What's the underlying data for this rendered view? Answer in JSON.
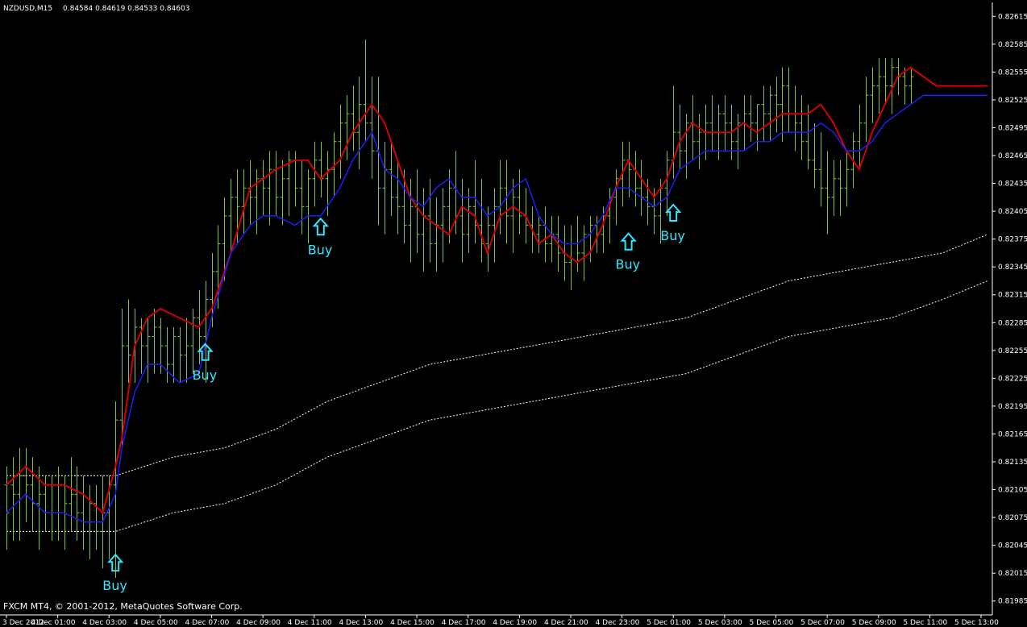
{
  "header": {
    "symbol": "NZDUSD,M15",
    "ohlc": "0.84584 0.84619 0.84533 0.84603"
  },
  "footer": {
    "copyright": "FXCM MT4, © 2001-2012, MetaQuotes Software Corp."
  },
  "colors": {
    "background": "#000000",
    "axis": "#ffffff",
    "bars": "#7ec63a",
    "ma_red": "#d40000",
    "ma_blue": "#1c1cff",
    "channel": "#ffffff",
    "signal": "#33e6ff"
  },
  "chart_data": {
    "type": "line",
    "ylim": [
      0.8197,
      0.8263
    ],
    "y_ticks": [
      "0.82615",
      "0.82585",
      "0.82555",
      "0.82525",
      "0.82495",
      "0.82465",
      "0.82435",
      "0.82405",
      "0.82375",
      "0.82345",
      "0.82315",
      "0.82285",
      "0.82255",
      "0.82225",
      "0.82195",
      "0.82165",
      "0.82135",
      "0.82105",
      "0.82075",
      "0.82045",
      "0.82015",
      "0.81985"
    ],
    "x_ticks": [
      "3 Dec 2012",
      "4 Dec 01:00",
      "4 Dec 03:00",
      "4 Dec 05:00",
      "4 Dec 07:00",
      "4 Dec 09:00",
      "4 Dec 11:00",
      "4 Dec 13:00",
      "4 Dec 15:00",
      "4 Dec 17:00",
      "4 Dec 19:00",
      "4 Dec 21:00",
      "4 Dec 23:00",
      "5 Dec 01:00",
      "5 Dec 03:00",
      "5 Dec 05:00",
      "5 Dec 07:00",
      "5 Dec 09:00",
      "5 Dec 11:00",
      "5 Dec 13:00"
    ],
    "x_tick_positions": [
      0,
      8,
      16,
      24,
      32,
      40,
      48,
      56,
      64,
      72,
      80,
      88,
      96,
      104,
      112,
      120,
      128,
      136,
      144,
      152
    ],
    "x_domain": [
      0,
      153
    ],
    "grid": false,
    "series": [
      {
        "role": "ma_red",
        "x": [
          0,
          3,
          6,
          9,
          12,
          15,
          17,
          18,
          20,
          22,
          24,
          27,
          30,
          32,
          35,
          38,
          40,
          42,
          45,
          47,
          49,
          52,
          54,
          56,
          57,
          59,
          61,
          63,
          65,
          67,
          69,
          71,
          73,
          75,
          77,
          79,
          81,
          83,
          85,
          87,
          89,
          91,
          93,
          95,
          97,
          99,
          101,
          103,
          105,
          107,
          109,
          111,
          113,
          115,
          117,
          119,
          121,
          123,
          125,
          127,
          129,
          131,
          133,
          135,
          137,
          139,
          141,
          143,
          145,
          147,
          149,
          151,
          153
        ],
        "y": [
          0.8211,
          0.8213,
          0.8211,
          0.8211,
          0.821,
          0.8208,
          0.8213,
          0.8216,
          0.8226,
          0.8229,
          0.823,
          0.8229,
          0.8228,
          0.823,
          0.8236,
          0.8243,
          0.8244,
          0.8245,
          0.8246,
          0.8246,
          0.8244,
          0.8246,
          0.8249,
          0.8251,
          0.8252,
          0.825,
          0.8246,
          0.8242,
          0.824,
          0.8239,
          0.8238,
          0.8241,
          0.824,
          0.8236,
          0.824,
          0.8241,
          0.824,
          0.8237,
          0.8238,
          0.8236,
          0.8235,
          0.8236,
          0.8239,
          0.8243,
          0.8246,
          0.8244,
          0.8242,
          0.8244,
          0.8248,
          0.825,
          0.8249,
          0.8249,
          0.8249,
          0.825,
          0.8249,
          0.825,
          0.8251,
          0.8251,
          0.8251,
          0.8252,
          0.825,
          0.8247,
          0.8245,
          0.8249,
          0.8252,
          0.8255,
          0.8256,
          0.8255,
          0.8254,
          0.8254,
          0.8254,
          0.8254,
          0.8254
        ]
      },
      {
        "role": "ma_blue",
        "x": [
          0,
          3,
          6,
          9,
          12,
          15,
          17,
          18,
          20,
          22,
          24,
          27,
          30,
          32,
          35,
          38,
          40,
          42,
          45,
          47,
          49,
          52,
          54,
          56,
          57,
          59,
          61,
          63,
          65,
          67,
          69,
          71,
          73,
          75,
          77,
          79,
          81,
          83,
          85,
          87,
          89,
          91,
          93,
          95,
          97,
          99,
          101,
          103,
          105,
          107,
          109,
          111,
          113,
          115,
          117,
          119,
          121,
          123,
          125,
          127,
          129,
          131,
          133,
          135,
          137,
          139,
          141,
          143,
          145,
          147,
          149,
          151,
          153
        ],
        "y": [
          0.8208,
          0.821,
          0.8208,
          0.8208,
          0.8207,
          0.8207,
          0.821,
          0.8215,
          0.8221,
          0.8224,
          0.8224,
          0.8222,
          0.8223,
          0.8229,
          0.8236,
          0.8239,
          0.824,
          0.824,
          0.8239,
          0.824,
          0.824,
          0.8243,
          0.8246,
          0.8248,
          0.8249,
          0.8245,
          0.8244,
          0.8242,
          0.8241,
          0.8243,
          0.8244,
          0.8242,
          0.8242,
          0.824,
          0.8241,
          0.8243,
          0.8244,
          0.824,
          0.8238,
          0.8237,
          0.8237,
          0.8238,
          0.824,
          0.8243,
          0.8243,
          0.8242,
          0.8241,
          0.8242,
          0.8245,
          0.8246,
          0.8247,
          0.8247,
          0.8247,
          0.8247,
          0.8248,
          0.8248,
          0.8249,
          0.8249,
          0.8249,
          0.825,
          0.8249,
          0.8247,
          0.8247,
          0.8248,
          0.825,
          0.8251,
          0.8252,
          0.8253,
          0.8253,
          0.8253,
          0.8253,
          0.8253,
          0.8253
        ]
      },
      {
        "role": "channel",
        "x": [
          0,
          17,
          26,
          34,
          42,
          50,
          58,
          66,
          74,
          82,
          90,
          98,
          106,
          114,
          122,
          130,
          138,
          146,
          153
        ],
        "y": [
          0.8212,
          0.8212,
          0.8214,
          0.8215,
          0.8217,
          0.822,
          0.8222,
          0.8224,
          0.8225,
          0.8226,
          0.8227,
          0.8228,
          0.8229,
          0.8231,
          0.8233,
          0.8234,
          0.8235,
          0.8236,
          0.8238
        ]
      },
      {
        "role": "channel",
        "x": [
          0,
          17,
          26,
          34,
          42,
          50,
          58,
          66,
          74,
          82,
          90,
          98,
          106,
          114,
          122,
          130,
          138,
          146,
          153
        ],
        "y": [
          0.8206,
          0.8206,
          0.8208,
          0.8209,
          0.8211,
          0.8214,
          0.8216,
          0.8218,
          0.8219,
          0.822,
          0.8221,
          0.8222,
          0.8223,
          0.8225,
          0.8227,
          0.8228,
          0.8229,
          0.8231,
          0.8233
        ]
      }
    ],
    "bars": [
      [
        0.8211,
        0.8213,
        0.8204,
        0.8208
      ],
      [
        0.8211,
        0.8214,
        0.8205,
        0.821
      ],
      [
        0.821,
        0.8215,
        0.8205,
        0.8212
      ],
      [
        0.8212,
        0.8215,
        0.8207,
        0.8211
      ],
      [
        0.8211,
        0.8214,
        0.8206,
        0.8209
      ],
      [
        0.8209,
        0.8213,
        0.8204,
        0.821
      ],
      [
        0.821,
        0.8212,
        0.8206,
        0.8208
      ],
      [
        0.8208,
        0.8212,
        0.8205,
        0.8211
      ],
      [
        0.8211,
        0.8213,
        0.8205,
        0.8208
      ],
      [
        0.8208,
        0.8212,
        0.8204,
        0.8209
      ],
      [
        0.8209,
        0.8214,
        0.8206,
        0.821
      ],
      [
        0.821,
        0.8213,
        0.8205,
        0.8208
      ],
      [
        0.8208,
        0.8212,
        0.8204,
        0.8207
      ],
      [
        0.8207,
        0.8211,
        0.8203,
        0.8209
      ],
      [
        0.8209,
        0.8211,
        0.8204,
        0.8206
      ],
      [
        0.8206,
        0.8212,
        0.8202,
        0.8208
      ],
      [
        0.8208,
        0.8212,
        0.8203,
        0.8211
      ],
      [
        0.8211,
        0.822,
        0.8201,
        0.8218
      ],
      [
        0.8218,
        0.823,
        0.8215,
        0.8226
      ],
      [
        0.8226,
        0.8231,
        0.8222,
        0.8225
      ],
      [
        0.8225,
        0.823,
        0.8222,
        0.8228
      ],
      [
        0.8228,
        0.8229,
        0.8223,
        0.8226
      ],
      [
        0.8226,
        0.8229,
        0.8222,
        0.8227
      ],
      [
        0.8227,
        0.823,
        0.8223,
        0.8228
      ],
      [
        0.8228,
        0.8229,
        0.8223,
        0.8226
      ],
      [
        0.8226,
        0.8228,
        0.8222,
        0.8224
      ],
      [
        0.8224,
        0.8228,
        0.8222,
        0.8227
      ],
      [
        0.8227,
        0.8228,
        0.8222,
        0.8225
      ],
      [
        0.8225,
        0.8229,
        0.8222,
        0.8226
      ],
      [
        0.8226,
        0.823,
        0.8223,
        0.8229
      ],
      [
        0.8229,
        0.8232,
        0.8224,
        0.8227
      ],
      [
        0.8227,
        0.8233,
        0.8222,
        0.8231
      ],
      [
        0.8231,
        0.8236,
        0.8228,
        0.8234
      ],
      [
        0.8234,
        0.8239,
        0.823,
        0.8237
      ],
      [
        0.8237,
        0.8242,
        0.8233,
        0.824
      ],
      [
        0.824,
        0.8244,
        0.8236,
        0.8242
      ],
      [
        0.8242,
        0.8245,
        0.8237,
        0.8241
      ],
      [
        0.8241,
        0.8245,
        0.8238,
        0.8243
      ],
      [
        0.8243,
        0.8246,
        0.8239,
        0.8242
      ],
      [
        0.8242,
        0.8245,
        0.8238,
        0.8244
      ],
      [
        0.8244,
        0.8246,
        0.824,
        0.8243
      ],
      [
        0.8243,
        0.8247,
        0.8239,
        0.8245
      ],
      [
        0.8245,
        0.8247,
        0.824,
        0.8242
      ],
      [
        0.8242,
        0.8246,
        0.8239,
        0.8244
      ],
      [
        0.8244,
        0.8247,
        0.824,
        0.8246
      ],
      [
        0.8246,
        0.8247,
        0.8241,
        0.8243
      ],
      [
        0.8243,
        0.8246,
        0.8238,
        0.8241
      ],
      [
        0.8241,
        0.8245,
        0.8237,
        0.8244
      ],
      [
        0.8244,
        0.8248,
        0.8241,
        0.8246
      ],
      [
        0.8246,
        0.8248,
        0.8242,
        0.8244
      ],
      [
        0.8244,
        0.8247,
        0.824,
        0.8245
      ],
      [
        0.8245,
        0.8249,
        0.8242,
        0.8248
      ],
      [
        0.8248,
        0.8252,
        0.8244,
        0.825
      ],
      [
        0.825,
        0.8253,
        0.8246,
        0.8251
      ],
      [
        0.8251,
        0.8254,
        0.8247,
        0.8249
      ],
      [
        0.8249,
        0.8255,
        0.8245,
        0.8252
      ],
      [
        0.8252,
        0.8259,
        0.8248,
        0.825
      ],
      [
        0.825,
        0.8255,
        0.8244,
        0.8247
      ],
      [
        0.8247,
        0.8255,
        0.8239,
        0.8243
      ],
      [
        0.8243,
        0.8248,
        0.8238,
        0.8245
      ],
      [
        0.8245,
        0.8248,
        0.824,
        0.8242
      ],
      [
        0.8242,
        0.8246,
        0.8238,
        0.8241
      ],
      [
        0.8241,
        0.8245,
        0.8237,
        0.8239
      ],
      [
        0.8239,
        0.8244,
        0.8235,
        0.8241
      ],
      [
        0.8241,
        0.8245,
        0.8236,
        0.8238
      ],
      [
        0.8238,
        0.8243,
        0.8234,
        0.824
      ],
      [
        0.824,
        0.8244,
        0.8235,
        0.8237
      ],
      [
        0.8237,
        0.8242,
        0.8234,
        0.8239
      ],
      [
        0.8239,
        0.8243,
        0.8235,
        0.8241
      ],
      [
        0.8241,
        0.8245,
        0.8237,
        0.8243
      ],
      [
        0.8243,
        0.8247,
        0.8238,
        0.824
      ],
      [
        0.824,
        0.8244,
        0.8235,
        0.8238
      ],
      [
        0.8238,
        0.8243,
        0.8236,
        0.8241
      ],
      [
        0.8241,
        0.8246,
        0.8237,
        0.8239
      ],
      [
        0.8239,
        0.8244,
        0.8235,
        0.8237
      ],
      [
        0.8237,
        0.8241,
        0.8234,
        0.8239
      ],
      [
        0.8239,
        0.8243,
        0.8235,
        0.8241
      ],
      [
        0.8241,
        0.8246,
        0.8238,
        0.8243
      ],
      [
        0.8243,
        0.8246,
        0.8237,
        0.824
      ],
      [
        0.824,
        0.8244,
        0.8236,
        0.8242
      ],
      [
        0.8242,
        0.8245,
        0.8238,
        0.824
      ],
      [
        0.824,
        0.8243,
        0.8237,
        0.8239
      ],
      [
        0.8239,
        0.8241,
        0.8236,
        0.8238
      ],
      [
        0.8238,
        0.824,
        0.8236,
        0.8239
      ],
      [
        0.8239,
        0.8241,
        0.8235,
        0.8237
      ],
      [
        0.8237,
        0.824,
        0.8235,
        0.8238
      ],
      [
        0.8238,
        0.824,
        0.8234,
        0.8236
      ],
      [
        0.8236,
        0.8239,
        0.8233,
        0.8235
      ],
      [
        0.8235,
        0.8239,
        0.8232,
        0.8237
      ],
      [
        0.8237,
        0.824,
        0.8234,
        0.8236
      ],
      [
        0.8236,
        0.8239,
        0.8233,
        0.8238
      ],
      [
        0.8238,
        0.824,
        0.8235,
        0.8239
      ],
      [
        0.8239,
        0.824,
        0.8236,
        0.8238
      ],
      [
        0.8238,
        0.8241,
        0.8236,
        0.824
      ],
      [
        0.824,
        0.8243,
        0.8237,
        0.8242
      ],
      [
        0.8242,
        0.8245,
        0.8239,
        0.8244
      ],
      [
        0.8244,
        0.8248,
        0.8241,
        0.8246
      ],
      [
        0.8246,
        0.8248,
        0.8242,
        0.8245
      ],
      [
        0.8245,
        0.8247,
        0.8241,
        0.8243
      ],
      [
        0.8243,
        0.8246,
        0.824,
        0.8242
      ],
      [
        0.8242,
        0.8244,
        0.8239,
        0.8241
      ],
      [
        0.8241,
        0.8243,
        0.8238,
        0.824
      ],
      [
        0.824,
        0.8244,
        0.8237,
        0.8243
      ],
      [
        0.8243,
        0.8247,
        0.824,
        0.8246
      ],
      [
        0.8246,
        0.8254,
        0.8244,
        0.8249
      ],
      [
        0.8249,
        0.8252,
        0.8245,
        0.8247
      ],
      [
        0.8247,
        0.8251,
        0.8244,
        0.825
      ],
      [
        0.825,
        0.8253,
        0.8246,
        0.8248
      ],
      [
        0.8248,
        0.8251,
        0.8245,
        0.8249
      ],
      [
        0.8249,
        0.8252,
        0.8246,
        0.825
      ],
      [
        0.825,
        0.8253,
        0.8247,
        0.8249
      ],
      [
        0.8249,
        0.8252,
        0.8246,
        0.8251
      ],
      [
        0.8251,
        0.8253,
        0.8247,
        0.825
      ],
      [
        0.825,
        0.8252,
        0.8246,
        0.8248
      ],
      [
        0.8248,
        0.8251,
        0.8245,
        0.825
      ],
      [
        0.825,
        0.8253,
        0.8247,
        0.8251
      ],
      [
        0.8251,
        0.8253,
        0.8248,
        0.825
      ],
      [
        0.825,
        0.8252,
        0.8247,
        0.8252
      ],
      [
        0.8252,
        0.8254,
        0.8248,
        0.8251
      ],
      [
        0.8251,
        0.8254,
        0.8248,
        0.8253
      ],
      [
        0.8253,
        0.8255,
        0.8249,
        0.8252
      ],
      [
        0.8252,
        0.8256,
        0.8248,
        0.8254
      ],
      [
        0.8254,
        0.8256,
        0.8249,
        0.8251
      ],
      [
        0.8251,
        0.8254,
        0.8247,
        0.825
      ],
      [
        0.825,
        0.8253,
        0.8246,
        0.8248
      ],
      [
        0.8248,
        0.8252,
        0.8245,
        0.8246
      ],
      [
        0.8246,
        0.825,
        0.8243,
        0.8245
      ],
      [
        0.8245,
        0.8249,
        0.8241,
        0.8243
      ],
      [
        0.8243,
        0.8247,
        0.8238,
        0.8242
      ],
      [
        0.8242,
        0.8246,
        0.824,
        0.8244
      ],
      [
        0.8244,
        0.8246,
        0.824,
        0.8243
      ],
      [
        0.8243,
        0.8247,
        0.8241,
        0.8245
      ],
      [
        0.8245,
        0.8249,
        0.8243,
        0.8248
      ],
      [
        0.8248,
        0.8252,
        0.8245,
        0.825
      ],
      [
        0.825,
        0.8255,
        0.8248,
        0.8253
      ],
      [
        0.8253,
        0.8256,
        0.825,
        0.8254
      ],
      [
        0.8254,
        0.8257,
        0.8251,
        0.8255
      ],
      [
        0.8255,
        0.8257,
        0.8252,
        0.8254
      ],
      [
        0.8254,
        0.8257,
        0.8251,
        0.8256
      ],
      [
        0.8256,
        0.8257,
        0.8253,
        0.8255
      ],
      [
        0.8255,
        0.8256,
        0.8252,
        0.8254
      ],
      [
        0.8254,
        0.8256,
        0.8252,
        0.8255
      ]
    ],
    "annotations": [
      {
        "label": "Buy",
        "x": 17,
        "y": 0.82035
      },
      {
        "label": "Buy",
        "x": 31,
        "y": 0.82262
      },
      {
        "label": "Buy",
        "x": 49,
        "y": 0.82397
      },
      {
        "label": "Buy",
        "x": 97,
        "y": 0.82381
      },
      {
        "label": "Buy",
        "x": 104,
        "y": 0.82412
      }
    ]
  }
}
